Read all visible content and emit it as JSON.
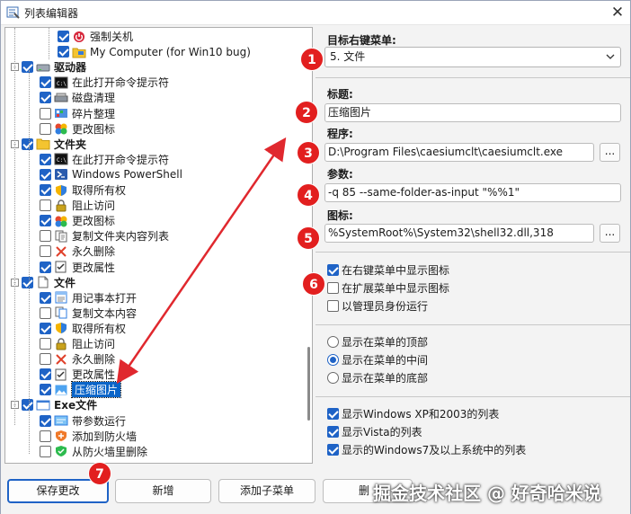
{
  "window": {
    "title": "列表编辑器",
    "close": "✕"
  },
  "tree": {
    "rows": [
      {
        "label": "强制关机",
        "level": 3,
        "checked": true,
        "icon": "power-icon",
        "expander": ""
      },
      {
        "label": "My Computer (for Win10 bug)",
        "level": 3,
        "checked": true,
        "icon": "computer-folder-icon",
        "expander": ""
      },
      {
        "label": "驱动器",
        "level": 0,
        "checked": true,
        "icon": "drive-icon",
        "expander": "-",
        "bold": true
      },
      {
        "label": "在此打开命令提示符",
        "level": 1,
        "checked": true,
        "icon": "cmd-icon",
        "expander": ""
      },
      {
        "label": "磁盘清理",
        "level": 1,
        "checked": true,
        "icon": "disk-cleanup-icon",
        "expander": ""
      },
      {
        "label": "碎片整理",
        "level": 1,
        "checked": false,
        "icon": "defrag-icon",
        "expander": ""
      },
      {
        "label": "更改图标",
        "level": 1,
        "checked": false,
        "icon": "change-icon-icon",
        "expander": ""
      },
      {
        "label": "文件夹",
        "level": 0,
        "checked": true,
        "icon": "folder-icon",
        "expander": "-",
        "bold": true
      },
      {
        "label": "在此打开命令提示符",
        "level": 1,
        "checked": true,
        "icon": "cmd-icon",
        "expander": ""
      },
      {
        "label": "Windows PowerShell",
        "level": 1,
        "checked": true,
        "icon": "powershell-icon",
        "expander": ""
      },
      {
        "label": "取得所有权",
        "level": 1,
        "checked": true,
        "icon": "shield-icon",
        "expander": ""
      },
      {
        "label": "阻止访问",
        "level": 1,
        "checked": false,
        "icon": "lock-icon",
        "expander": ""
      },
      {
        "label": "更改图标",
        "level": 1,
        "checked": true,
        "icon": "change-icon-icon",
        "expander": ""
      },
      {
        "label": "复制文件夹内容列表",
        "level": 1,
        "checked": false,
        "icon": "copy-list-icon",
        "expander": ""
      },
      {
        "label": "永久删除",
        "level": 1,
        "checked": false,
        "icon": "delete-x-icon",
        "expander": ""
      },
      {
        "label": "更改属性",
        "level": 1,
        "checked": true,
        "icon": "attributes-icon",
        "expander": ""
      },
      {
        "label": "文件",
        "level": 0,
        "checked": true,
        "icon": "file-icon",
        "expander": "-",
        "bold": true
      },
      {
        "label": "用记事本打开",
        "level": 1,
        "checked": true,
        "icon": "notepad-icon",
        "expander": ""
      },
      {
        "label": "复制文本内容",
        "level": 1,
        "checked": false,
        "icon": "copy-text-icon",
        "expander": ""
      },
      {
        "label": "取得所有权",
        "level": 1,
        "checked": true,
        "icon": "shield-icon",
        "expander": ""
      },
      {
        "label": "阻止访问",
        "level": 1,
        "checked": false,
        "icon": "lock-icon",
        "expander": ""
      },
      {
        "label": "永久删除",
        "level": 1,
        "checked": false,
        "icon": "delete-x-icon",
        "expander": ""
      },
      {
        "label": "更改属性",
        "level": 1,
        "checked": true,
        "icon": "attributes-icon",
        "expander": ""
      },
      {
        "label": "压缩图片",
        "level": 1,
        "checked": true,
        "icon": "image-icon",
        "expander": "",
        "selected": true
      },
      {
        "label": "Exe文件",
        "level": 0,
        "checked": true,
        "icon": "exe-window-icon",
        "expander": "-",
        "bold": true
      },
      {
        "label": "带参数运行",
        "level": 1,
        "checked": true,
        "icon": "run-params-icon",
        "expander": ""
      },
      {
        "label": "添加到防火墙",
        "level": 1,
        "checked": false,
        "icon": "firewall-add-icon",
        "expander": ""
      },
      {
        "label": "从防火墙里删除",
        "level": 1,
        "checked": false,
        "icon": "firewall-remove-icon",
        "expander": ""
      }
    ]
  },
  "form": {
    "target_menu_label": "目标右键菜单:",
    "target_menu_value": "5. 文件",
    "title_label": "标题:",
    "title_value": "压缩图片",
    "program_label": "程序:",
    "program_value": "D:\\Program Files\\caesiumclt\\caesiumclt.exe",
    "params_label": "参数:",
    "params_value": "-q 85 --same-folder-as-input \"%%1\"",
    "icon_label": "图标:",
    "icon_value": "%SystemRoot%\\System32\\shell32.dll,318",
    "browse": "..."
  },
  "options": {
    "checks": [
      {
        "label": "在右键菜单中显示图标",
        "checked": true
      },
      {
        "label": "在扩展菜单中显示图标",
        "checked": false
      },
      {
        "label": "以管理员身份运行",
        "checked": false
      }
    ],
    "radios": [
      {
        "label": "显示在菜单的顶部",
        "checked": false
      },
      {
        "label": "显示在菜单的中间",
        "checked": true
      },
      {
        "label": "显示在菜单的底部",
        "checked": false
      }
    ],
    "lists": [
      {
        "label": "显示Windows XP和2003的列表",
        "checked": true
      },
      {
        "label": "显示Vista的列表",
        "checked": true
      },
      {
        "label": "显示的Windows7及以上系统中的列表",
        "checked": true
      }
    ]
  },
  "buttons": {
    "save": "保存更改",
    "add": "新增",
    "add_sub": "添加子菜单",
    "delete_partial": "删"
  },
  "badges": [
    "1",
    "2",
    "3",
    "4",
    "5",
    "6",
    "7"
  ],
  "watermark": "掘金技术社区 @ 好奇哈米说",
  "colors": {
    "accent": "#1f63c6",
    "badge": "#e21f1f",
    "arrow": "#e0282e",
    "selection": "#0a64c8"
  }
}
